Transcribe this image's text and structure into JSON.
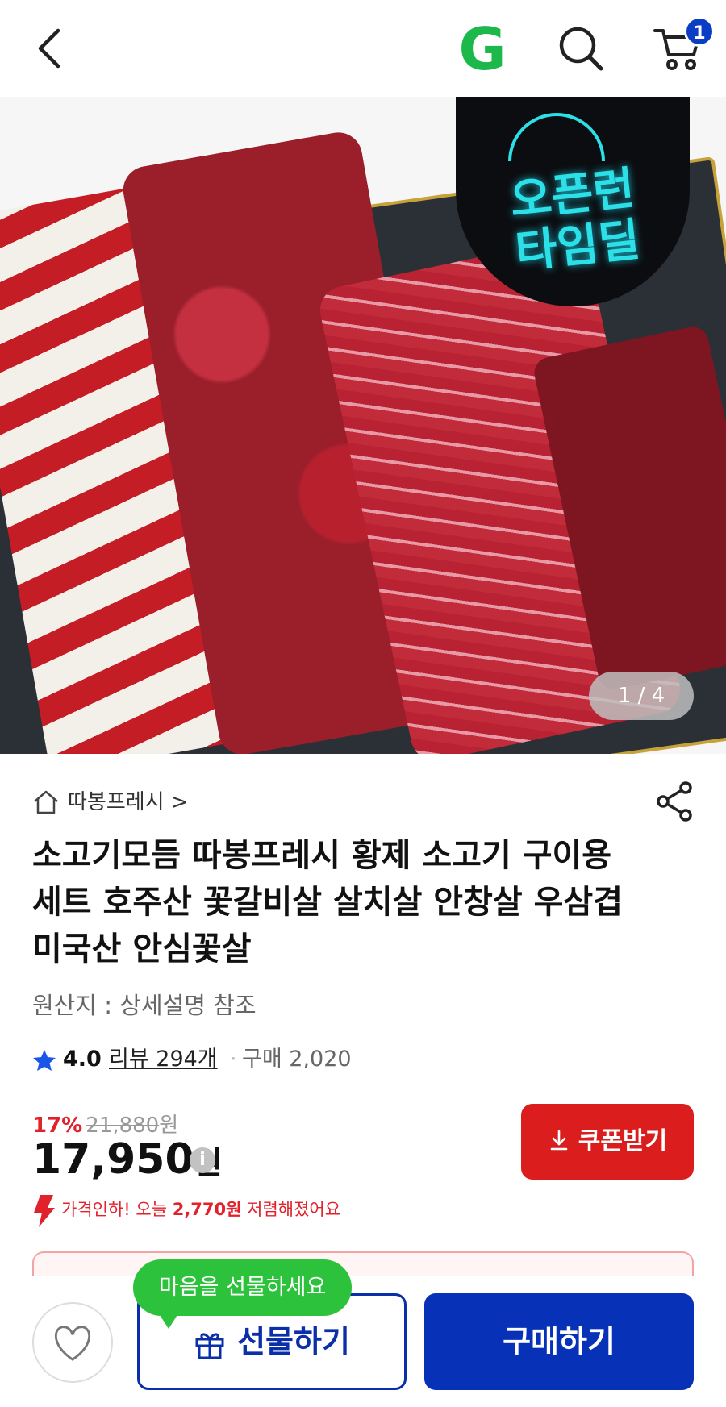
{
  "header": {
    "back_icon": "chevron-left-icon",
    "logo_text": "G",
    "search_icon": "search-icon",
    "cart_icon": "cart-icon",
    "cart_count": "1"
  },
  "hero": {
    "promo_text_line1": "오픈런",
    "promo_text_line2": "타임딜",
    "counter": "1 / 4"
  },
  "product": {
    "store_name": "따봉프레시 >",
    "title": "소고기모듬 따봉프레시 황제 소고기 구이용 세트 호주산 꽃갈비살 살치살 안창살 우삼겹 미국산 안심꽃살",
    "origin": "원산지 : 상세설명 참조",
    "rating": "4.0",
    "review_text": "리뷰 294개",
    "separator": "·",
    "purchase_text": "구매 2,020",
    "discount_pct": "17%",
    "original_price": "21,880",
    "original_won": "원",
    "price": "17,950",
    "price_won": "원",
    "info_icon_text": "i",
    "coupon_label": "쿠폰받기",
    "price_drop_prefix": "가격인하! 오늘 ",
    "price_drop_amount": "2,770원",
    "price_drop_suffix": " 저렴해졌어요"
  },
  "bottom": {
    "tooltip": "마음을 선물하세요",
    "gift_label": "선물하기",
    "buy_label": "구매하기"
  },
  "colors": {
    "accent_blue": "#0732b8",
    "coupon_red": "#dc1d1d",
    "tooltip_green": "#2cc23b",
    "logo_green": "#1db84a"
  }
}
